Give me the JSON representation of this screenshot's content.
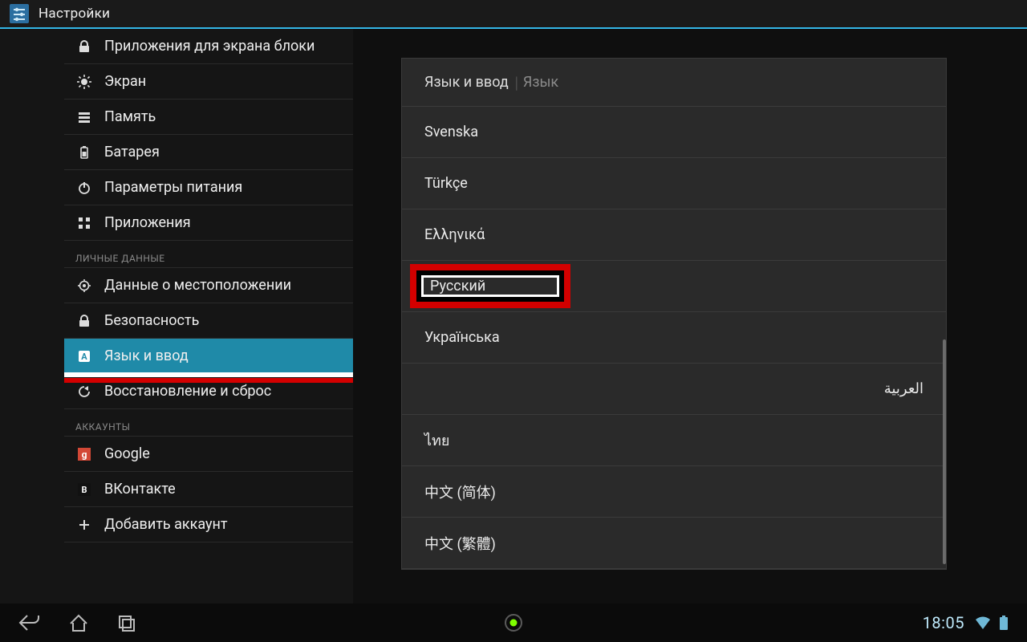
{
  "titlebar": {
    "title": "Настройки"
  },
  "sidebar": {
    "groups": [
      {
        "items": [
          {
            "icon": "lock-icon",
            "label": "Приложения для экрана блоки"
          },
          {
            "icon": "brightness-icon",
            "label": "Экран"
          },
          {
            "icon": "storage-icon",
            "label": "Память"
          },
          {
            "icon": "battery-icon",
            "label": "Батарея"
          },
          {
            "icon": "power-icon",
            "label": "Параметры питания"
          },
          {
            "icon": "apps-icon",
            "label": "Приложения"
          }
        ]
      },
      {
        "header": "ЛИЧНЫЕ ДАННЫЕ",
        "items": [
          {
            "icon": "location-icon",
            "label": "Данные о местоположении"
          },
          {
            "icon": "lock-icon",
            "label": "Безопасность"
          },
          {
            "icon": "language-icon",
            "label": "Язык и ввод",
            "selected": true
          },
          {
            "icon": "backup-icon",
            "label": "Восстановление и сброс"
          }
        ]
      },
      {
        "header": "АККАУНТЫ",
        "items": [
          {
            "icon": "google-icon",
            "label": "Google"
          },
          {
            "icon": "vk-icon",
            "label": "ВКонтакте"
          },
          {
            "icon": "plus-icon",
            "label": "Добавить аккаунт"
          }
        ]
      }
    ]
  },
  "content": {
    "breadcrumb": {
      "parent": "Язык и ввод",
      "current": "Язык"
    },
    "languages": [
      {
        "label": "Svenska"
      },
      {
        "label": "Türkçe"
      },
      {
        "label": "Ελληνικά"
      },
      {
        "label": "Русский",
        "highlighted": true
      },
      {
        "label": "Українська"
      },
      {
        "label": "العربية"
      },
      {
        "label": "ไทย"
      },
      {
        "label": "中文 (简体)"
      },
      {
        "label": "中文 (繁體)"
      }
    ]
  },
  "navbar": {
    "time": "18:05"
  },
  "colors": {
    "accent": "#33b5e5",
    "highlight_red": "#d30000"
  }
}
